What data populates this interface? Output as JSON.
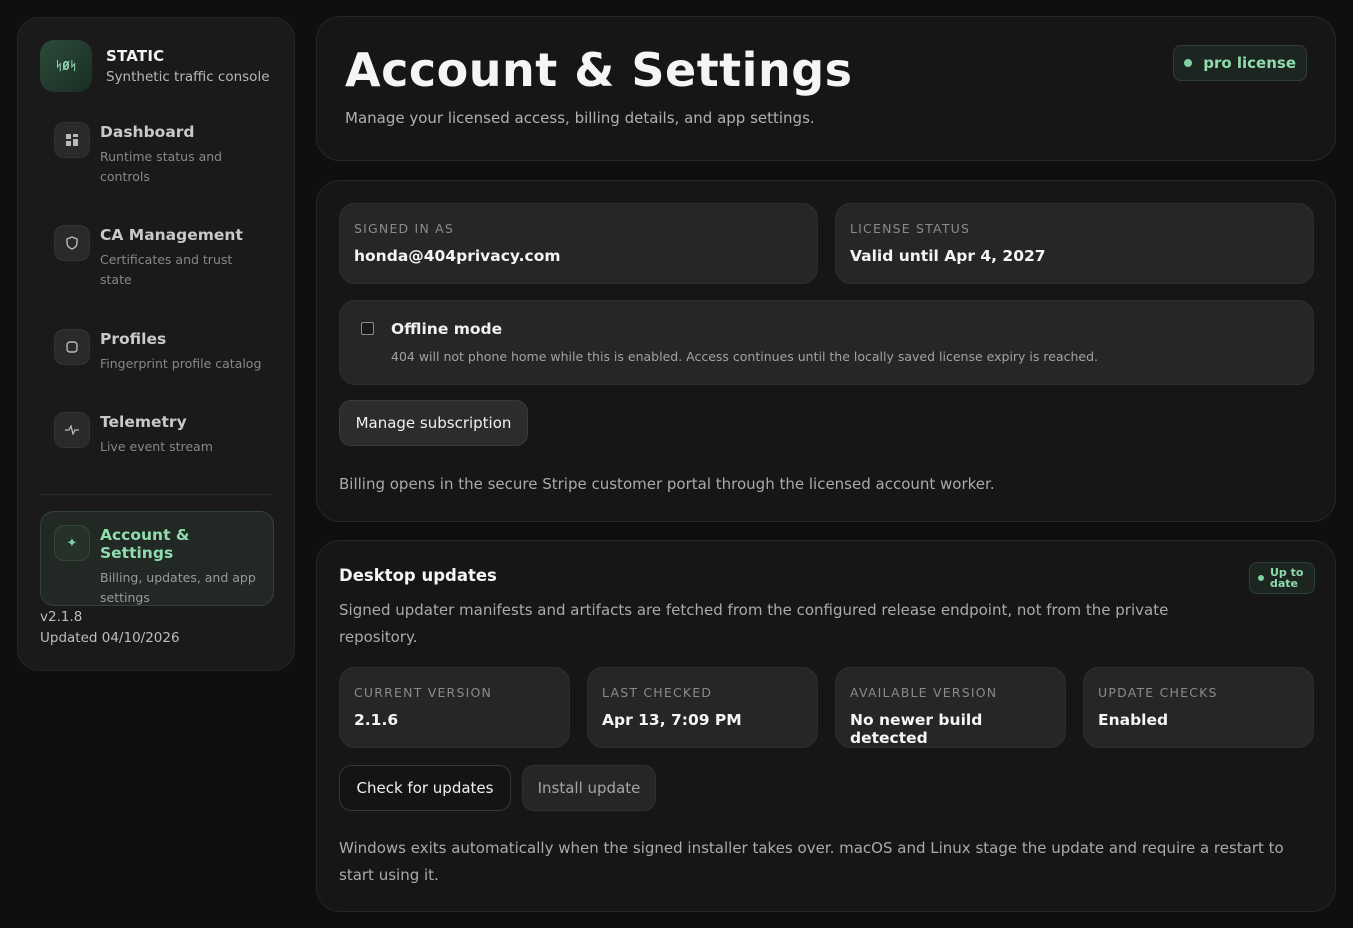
{
  "sidebar": {
    "brand": {
      "logo": "ᛋØᛋ",
      "name": "STATIC",
      "subtitle": "Synthetic traffic console"
    },
    "items": [
      {
        "title": "Dashboard",
        "subtitle": "Runtime status and controls",
        "icon": "dashboard-grid-icon"
      },
      {
        "title": "CA Management",
        "subtitle": "Certificates and trust state",
        "icon": "shield-icon"
      },
      {
        "title": "Profiles",
        "subtitle": "Fingerprint profile catalog",
        "icon": "profile-square-icon"
      },
      {
        "title": "Telemetry",
        "subtitle": "Live event stream",
        "icon": "pulse-icon"
      }
    ],
    "active": {
      "title": "Account & Settings",
      "subtitle": "Billing, updates, and app settings",
      "icon": "sparkle-icon"
    },
    "version": "v2.1.8",
    "updated": "Updated 04/10/2026"
  },
  "header": {
    "title": "Account & Settings",
    "subtitle": "Manage your licensed access, billing details, and app settings.",
    "badge": "pro license"
  },
  "account": {
    "signed_in_label": "SIGNED IN AS",
    "signed_in_value": "honda@404privacy.com",
    "license_label": "LICENSE STATUS",
    "license_value": "Valid until Apr 4, 2027",
    "offline_title": "Offline mode",
    "offline_desc": "404 will not phone home while this is enabled. Access continues until the locally saved license expiry is reached.",
    "offline_enabled": false,
    "manage_button": "Manage subscription",
    "billing_note": "Billing opens in the secure Stripe customer portal through the licensed account worker."
  },
  "updates": {
    "title": "Desktop updates",
    "badge": "Up to date",
    "description": "Signed updater manifests and artifacts are fetched from the configured release endpoint, not from the private repository.",
    "fields": [
      {
        "label": "CURRENT VERSION",
        "value": "2.1.6"
      },
      {
        "label": "LAST CHECKED",
        "value": "Apr 13, 7:09 PM"
      },
      {
        "label": "AVAILABLE VERSION",
        "value": "No newer build detected"
      },
      {
        "label": "UPDATE CHECKS",
        "value": "Enabled"
      }
    ],
    "check_button": "Check for updates",
    "install_button": "Install update",
    "note": "Windows exits automatically when the signed installer takes over. macOS and Linux stage the update and require a restart to start using it."
  },
  "colors": {
    "accent": "#8fdcae",
    "background": "#0f0f0f",
    "card": "#161616"
  }
}
